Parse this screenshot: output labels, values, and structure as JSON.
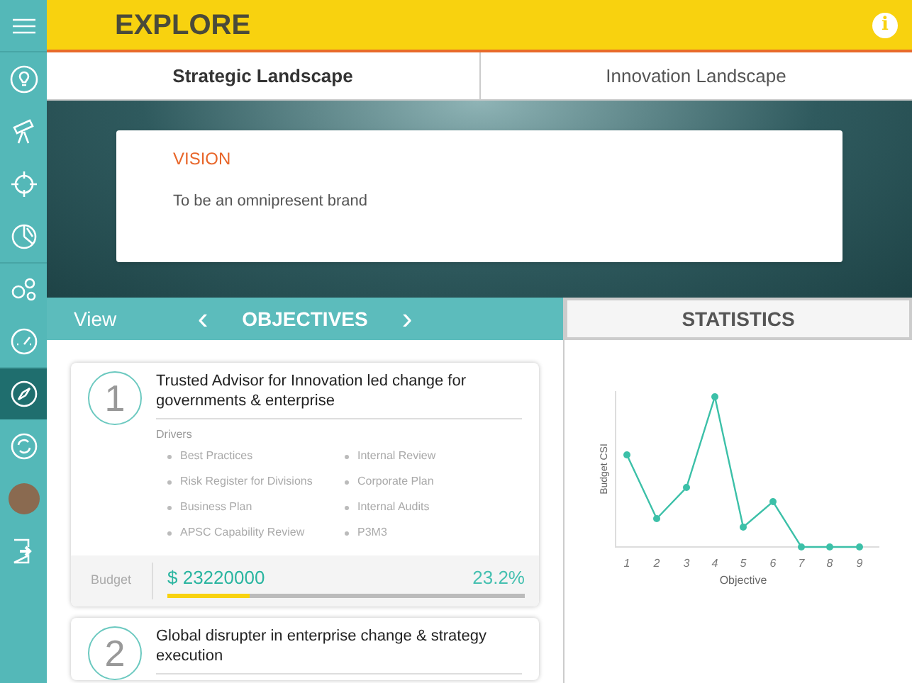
{
  "header": {
    "title": "EXPLORE",
    "info_icon": "i"
  },
  "sidebar": {
    "items": [
      {
        "kind": "bulb",
        "selected": false
      },
      {
        "kind": "telescope",
        "selected": false
      },
      {
        "kind": "target",
        "selected": false
      },
      {
        "kind": "pie",
        "selected": false
      },
      {
        "kind": "gears",
        "selected": false
      },
      {
        "kind": "gauge",
        "selected": false
      },
      {
        "kind": "compass",
        "selected": true
      },
      {
        "kind": "refresh",
        "selected": false
      },
      {
        "kind": "avatar",
        "selected": false
      },
      {
        "kind": "exit",
        "selected": false
      }
    ]
  },
  "tabs": [
    {
      "label": "Strategic Landscape",
      "selected": true
    },
    {
      "label": "Innovation Landscape",
      "selected": false
    }
  ],
  "vision": {
    "heading": "VISION",
    "text": "To be an omnipresent brand"
  },
  "objectives_bar": {
    "view": "View",
    "prev": "‹",
    "title": "OBJECTIVES",
    "next": "›"
  },
  "objectives": [
    {
      "number": "1",
      "title": "Trusted Advisor for Innovation led change for governments & enterprise",
      "drivers_label": "Drivers",
      "drivers": [
        "Best Practices",
        "Internal Review",
        "Risk Register for Divisions",
        "Corporate Plan",
        "Business Plan",
        "Internal Audits",
        "APSC Capability Review",
        "P3M3"
      ],
      "budget_label": "Budget",
      "budget": "$ 23220000",
      "percent": "23.2%",
      "level": 0.232
    },
    {
      "number": "2",
      "title": "Global disrupter in enterprise change & strategy execution"
    }
  ],
  "statistics": {
    "title": "STATISTICS",
    "ylabel": "Budget CSI",
    "xlabel": "Objective",
    "categories": [
      "1",
      "2",
      "3",
      "4",
      "5",
      "6",
      "7",
      "8",
      "9"
    ]
  }
}
